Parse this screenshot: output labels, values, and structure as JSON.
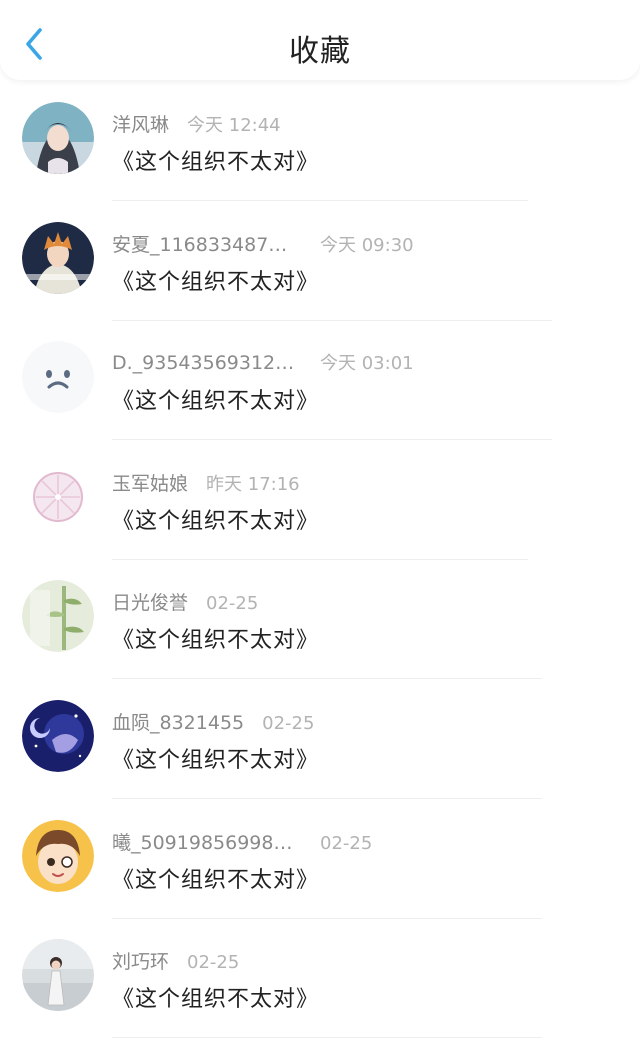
{
  "header": {
    "title": "收藏",
    "back_icon": "chevron-left-icon",
    "accent": "#3aa6e8"
  },
  "items": [
    {
      "user": "洋风琳",
      "time": "今天 12:44",
      "book": "《这个组织不太对》",
      "avatar": "anime-girl-avatar"
    },
    {
      "user": "安夏_116833487…",
      "time": "今天 09:30",
      "book": "《这个组织不太对》",
      "avatar": "anime-boy-avatar"
    },
    {
      "user": "D._93543569312…",
      "time": "今天 03:01",
      "book": "《这个组织不太对》",
      "avatar": "sad-face-avatar"
    },
    {
      "user": "玉军姑娘",
      "time": "昨天 17:16",
      "book": "《这个组织不太对》",
      "avatar": "lemon-slice-avatar"
    },
    {
      "user": "日光俊誉",
      "time": "02-25",
      "book": "《这个组织不太对》",
      "avatar": "plant-avatar"
    },
    {
      "user": "血陨_8321455",
      "time": "02-25",
      "book": "《这个组织不太对》",
      "avatar": "night-sky-avatar"
    },
    {
      "user": "曦_50919856998…",
      "time": "02-25",
      "book": "《这个组织不太对》",
      "avatar": "cartoon-boy-avatar"
    },
    {
      "user": "刘巧环",
      "time": "02-25",
      "book": "《这个组织不太对》",
      "avatar": "photo-girl-avatar"
    }
  ]
}
